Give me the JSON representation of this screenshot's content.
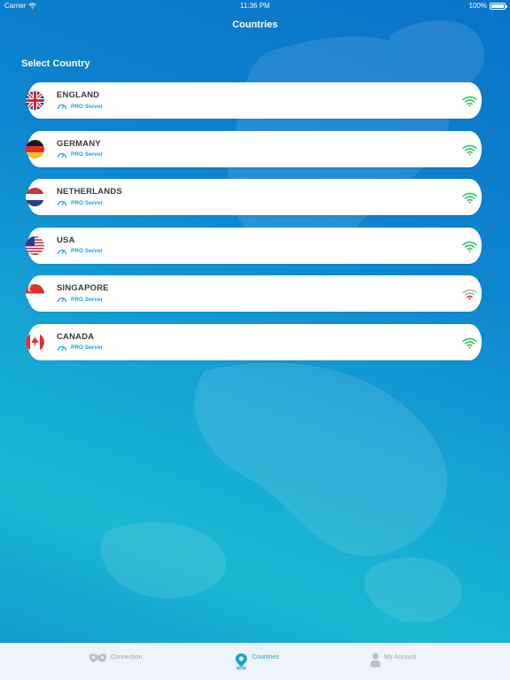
{
  "status_bar": {
    "carrier": "Carrier",
    "time": "11:36 PM",
    "battery": "100%"
  },
  "nav": {
    "title": "Countries"
  },
  "section_title": "Select Country",
  "countries": [
    {
      "name": "ENGLAND",
      "server": "PRO Server",
      "flag": "uk-flag",
      "signal": "good"
    },
    {
      "name": "GERMANY",
      "server": "PRO Server",
      "flag": "germany-flag",
      "signal": "good"
    },
    {
      "name": "NETHERLANDS",
      "server": "PRO Server",
      "flag": "netherlands-flag",
      "signal": "good"
    },
    {
      "name": "USA",
      "server": "PRO Server",
      "flag": "usa-flag",
      "signal": "good"
    },
    {
      "name": "SINGAPORE",
      "server": "PRO Server",
      "flag": "singapore-flag",
      "signal": "weak"
    },
    {
      "name": "CANADA",
      "server": "PRO Server",
      "flag": "canada-flag",
      "signal": "good"
    }
  ],
  "tabs": [
    {
      "label": "Connection",
      "icon": "mask-icon",
      "active": false
    },
    {
      "label": "Countries",
      "icon": "map-pin-icon",
      "active": true
    },
    {
      "label": "My Account",
      "icon": "person-icon",
      "active": false
    }
  ],
  "colors": {
    "accent": "#1aa3cf",
    "signal_good": "#3ec86e",
    "signal_weak_bars": "#b7b7b7",
    "signal_weak_dot": "#e0312e",
    "tab_inactive": "#9aa3ab"
  }
}
